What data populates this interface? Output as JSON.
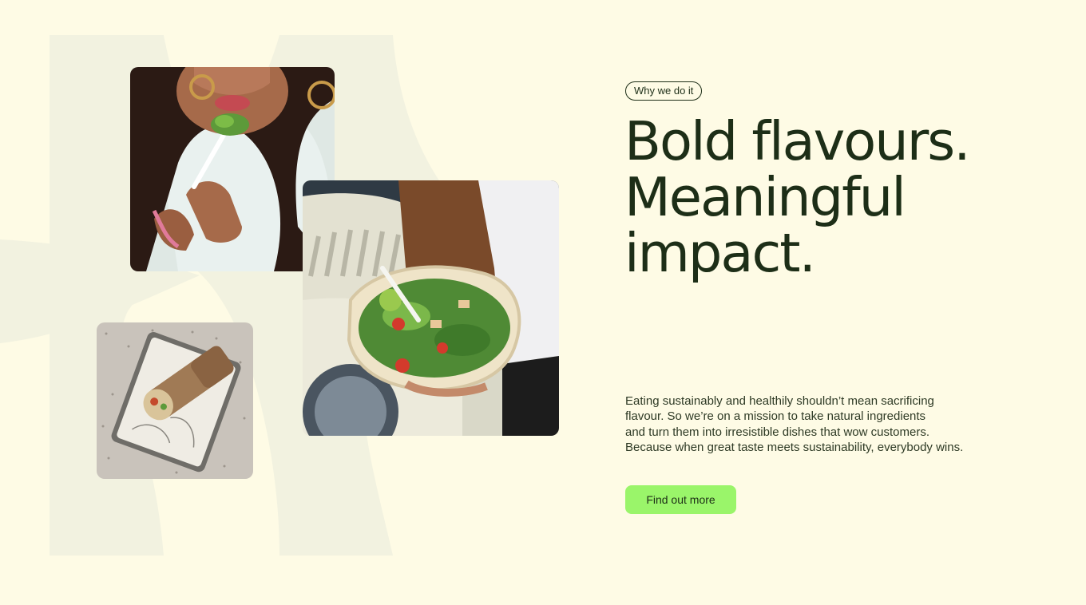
{
  "hero": {
    "eyebrow": "Why we do it",
    "headline_lines": [
      "Bold flavours.",
      "Meaningful",
      "impact."
    ],
    "body_lines": [
      "Eating sustainably and healthily shouldn’t mean sacrificing",
      "flavour. So we’re on a mission to take natural ingredients",
      "and turn them into irresistible dishes that wow customers.",
      "Because when great taste meets sustainability, everybody wins."
    ],
    "cta_label": "Find out more"
  },
  "images": {
    "photo_1": "woman-eating-salad",
    "photo_2": "hand-holding-salad-bowl",
    "photo_3": "wrap-on-tray"
  },
  "colors": {
    "background": "#fefbe5",
    "decorative_shape": "#f2f2e0",
    "text": "#1d2e17",
    "cta": "#9af56a"
  }
}
